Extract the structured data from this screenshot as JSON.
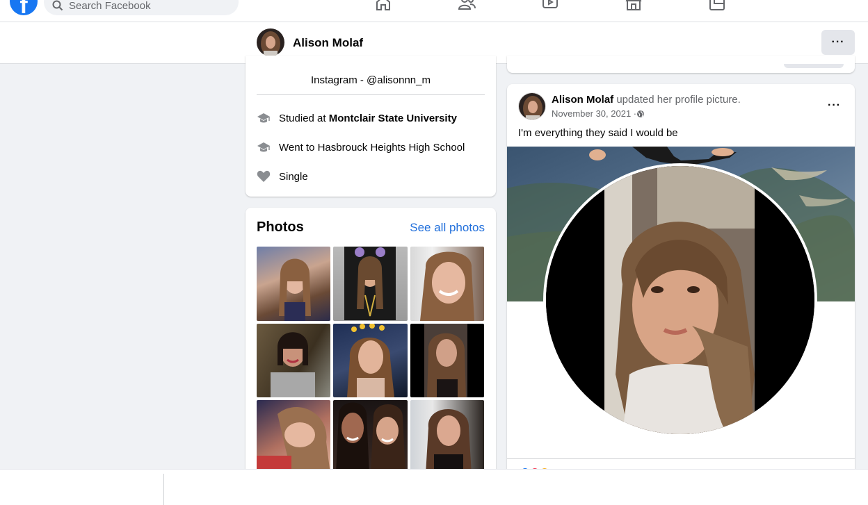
{
  "nav": {
    "search_placeholder": "Search Facebook",
    "logo_letter": "f",
    "icons": [
      "home-icon",
      "friends-icon",
      "watch-icon",
      "marketplace-icon",
      "gaming-icon"
    ]
  },
  "profile_bar": {
    "name": "Alison Molaf",
    "more_label": "···"
  },
  "intro": {
    "instagram": "Instagram - @alisonnn_m",
    "items": [
      {
        "icon": "graduation-cap-icon",
        "prefix": "Studied at ",
        "bold": "Montclair State University"
      },
      {
        "icon": "graduation-cap-icon",
        "text": "Went to Hasbrouck Heights High School"
      },
      {
        "icon": "heart-icon",
        "text": "Single"
      }
    ]
  },
  "photos": {
    "title": "Photos",
    "see_all": "See all photos",
    "count": 9
  },
  "post": {
    "author": "Alison Molaf",
    "action": " updated her profile picture.",
    "date": "November 30, 2021 · ",
    "privacy_icon": "globe-icon",
    "text": "I'm everything they said I would be",
    "more_label": "···"
  },
  "colors": {
    "brand": "#1877f2",
    "link": "#216fdb",
    "secondary_text": "#65676b",
    "page_bg": "#f0f2f5"
  }
}
